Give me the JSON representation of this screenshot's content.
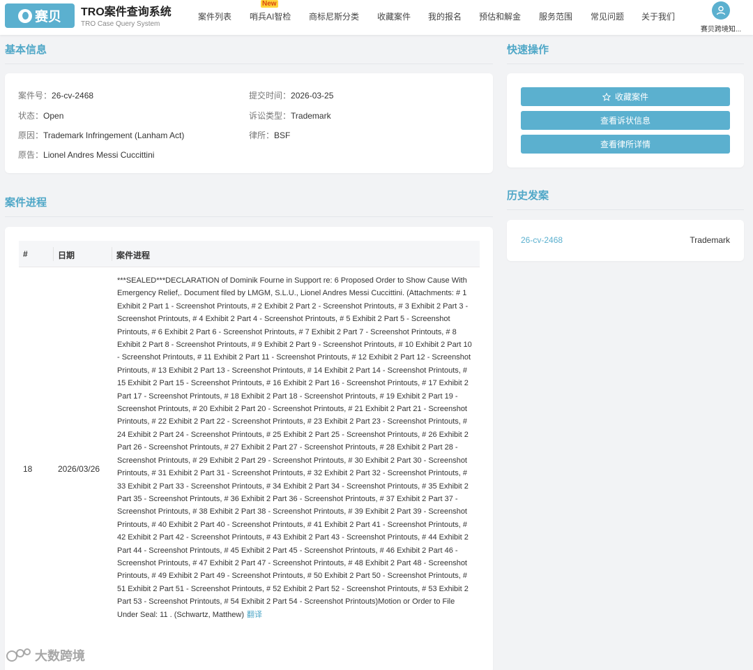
{
  "header": {
    "logo_text": "赛贝",
    "title": "TRO案件查询系统",
    "subtitle": "TRO Case Query System",
    "nav": [
      "案件列表",
      "哨兵AI智检",
      "商标尼斯分类",
      "收藏案件",
      "我的报名",
      "预估和解金",
      "服务范围",
      "常见问题",
      "关于我们"
    ],
    "nav_badge": "New",
    "user_name": "赛贝跨境知..."
  },
  "basic_info": {
    "title": "基本信息",
    "case_no_label": "案件号：",
    "case_no": "26-cv-2468",
    "submit_label": "提交时间：",
    "submit_date": "2026-03-25",
    "status_label": "状态：",
    "status": "Open",
    "type_label": "诉讼类型：",
    "type": "Trademark",
    "cause_label": "原因：",
    "cause": "Trademark Infringement (Lanham Act)",
    "firm_label": "律所：",
    "firm": "BSF",
    "plaintiff_label": "原告：",
    "plaintiff": "Lionel Andres Messi Cuccittini"
  },
  "quick_actions": {
    "title": "快速操作",
    "favorite": "收藏案件",
    "complaint": "查看诉状信息",
    "firm_detail": "查看律所详情"
  },
  "history": {
    "title": "历史发案",
    "case_no": "26-cv-2468",
    "type": "Trademark"
  },
  "progress": {
    "title": "案件进程",
    "headers": [
      "#",
      "日期",
      "案件进程"
    ],
    "row": {
      "num": "18",
      "date": "2026/03/26",
      "text": "***SEALED***DECLARATION of Dominik Fourne in Support re: 6 Proposed Order to Show Cause With Emergency Relief,. Document filed by LMGM, S.L.U., Lionel Andres Messi Cuccittini. (Attachments: # 1 Exhibit 2 Part 1 - Screenshot Printouts, # 2 Exhibit 2 Part 2 - Screenshot Printouts, # 3 Exhibit 2 Part 3 - Screenshot Printouts, # 4 Exhibit 2 Part 4 - Screenshot Printouts, # 5 Exhibit 2 Part 5 - Screenshot Printouts, # 6 Exhibit 2 Part 6 - Screenshot Printouts, # 7 Exhibit 2 Part 7 - Screenshot Printouts, # 8 Exhibit 2 Part 8 - Screenshot Printouts, # 9 Exhibit 2 Part 9 - Screenshot Printouts, # 10 Exhibit 2 Part 10 - Screenshot Printouts, # 11 Exhibit 2 Part 11 - Screenshot Printouts, # 12 Exhibit 2 Part 12 - Screenshot Printouts, # 13 Exhibit 2 Part 13 - Screenshot Printouts, # 14 Exhibit 2 Part 14 - Screenshot Printouts, # 15 Exhibit 2 Part 15 - Screenshot Printouts, # 16 Exhibit 2 Part 16 - Screenshot Printouts, # 17 Exhibit 2 Part 17 - Screenshot Printouts, # 18 Exhibit 2 Part 18 - Screenshot Printouts, # 19 Exhibit 2 Part 19 - Screenshot Printouts, # 20 Exhibit 2 Part 20 - Screenshot Printouts, # 21 Exhibit 2 Part 21 - Screenshot Printouts, # 22 Exhibit 2 Part 22 - Screenshot Printouts, # 23 Exhibit 2 Part 23 - Screenshot Printouts, # 24 Exhibit 2 Part 24 - Screenshot Printouts, # 25 Exhibit 2 Part 25 - Screenshot Printouts, # 26 Exhibit 2 Part 26 - Screenshot Printouts, # 27 Exhibit 2 Part 27 - Screenshot Printouts, # 28 Exhibit 2 Part 28 - Screenshot Printouts, # 29 Exhibit 2 Part 29 - Screenshot Printouts, # 30 Exhibit 2 Part 30 - Screenshot Printouts, # 31 Exhibit 2 Part 31 - Screenshot Printouts, # 32 Exhibit 2 Part 32 - Screenshot Printouts, # 33 Exhibit 2 Part 33 - Screenshot Printouts, # 34 Exhibit 2 Part 34 - Screenshot Printouts, # 35 Exhibit 2 Part 35 - Screenshot Printouts, # 36 Exhibit 2 Part 36 - Screenshot Printouts, # 37 Exhibit 2 Part 37 - Screenshot Printouts, # 38 Exhibit 2 Part 38 - Screenshot Printouts, # 39 Exhibit 2 Part 39 - Screenshot Printouts, # 40 Exhibit 2 Part 40 - Screenshot Printouts, # 41 Exhibit 2 Part 41 - Screenshot Printouts, # 42 Exhibit 2 Part 42 - Screenshot Printouts, # 43 Exhibit 2 Part 43 - Screenshot Printouts, # 44 Exhibit 2 Part 44 - Screenshot Printouts, # 45 Exhibit 2 Part 45 - Screenshot Printouts, # 46 Exhibit 2 Part 46 - Screenshot Printouts, # 47 Exhibit 2 Part 47 - Screenshot Printouts, # 48 Exhibit 2 Part 48 - Screenshot Printouts, # 49 Exhibit 2 Part 49 - Screenshot Printouts, # 50 Exhibit 2 Part 50 - Screenshot Printouts, # 51 Exhibit 2 Part 51 - Screenshot Printouts, # 52 Exhibit 2 Part 52 - Screenshot Printouts, # 53 Exhibit 2 Part 53 - Screenshot Printouts, # 54 Exhibit 2 Part 54 - Screenshot Printouts)Motion or Order to File Under Seal: 11 . (Schwartz, Matthew)",
      "translate": "翻译"
    }
  },
  "watermark": "大数跨境",
  "colors": {
    "accent": "#5bb0cf",
    "title": "#4fa7c7",
    "background": "#f2f3f5"
  }
}
